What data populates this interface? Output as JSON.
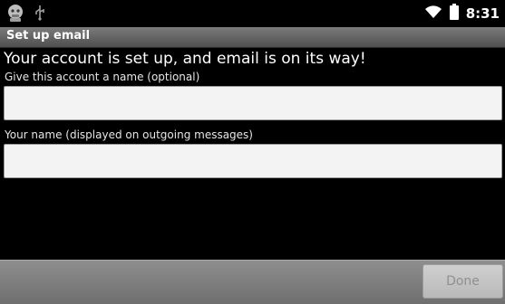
{
  "status_bar": {
    "time": "8:31",
    "icons": [
      "android-notification-icon",
      "usb-icon",
      "wifi-icon",
      "battery-icon"
    ]
  },
  "title_bar": {
    "title": "Set up email"
  },
  "content": {
    "headline": "Your account is set up, and email is on its way!",
    "account_name_label": "Give this account a name (optional)",
    "account_name_value": "",
    "your_name_label": "Your name (displayed on outgoing messages)",
    "your_name_value": ""
  },
  "bottom_bar": {
    "done_label": "Done"
  },
  "colors": {
    "background": "#000000",
    "title_bar": "#6a6a6a",
    "field_bg": "#f3f3f3",
    "disabled_text": "#8f8f8f"
  }
}
